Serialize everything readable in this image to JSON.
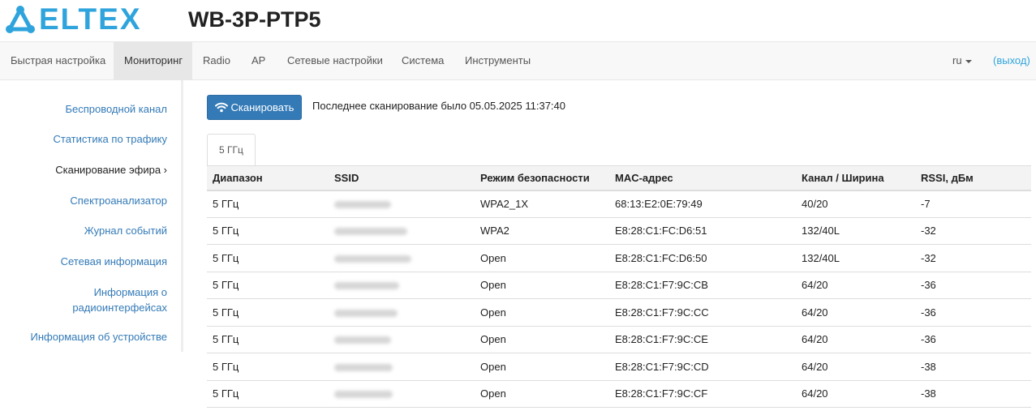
{
  "header": {
    "logo_text": "ELTEX",
    "device_title": "WB-3P-PTP5"
  },
  "nav": {
    "items": [
      "Быстрая настройка",
      "Мониторинг",
      "Radio",
      "AP",
      "Сетевые настройки",
      "Система",
      "Инструменты"
    ],
    "active": "Мониторинг",
    "lang": "ru",
    "logout": "(выход)"
  },
  "sidebar": {
    "items": [
      "Беспроводной канал",
      "Статистика по трафику",
      "Сканирование эфира ›",
      "Спектроанализатор",
      "Журнал событий",
      "Сетевая информация",
      "Информация о радиоинтерфейсах",
      "Информация об устройстве"
    ],
    "current": "Сканирование эфира ›"
  },
  "scan": {
    "button_label": "Сканировать",
    "last_scan_text": "Последнее сканирование было 05.05.2025 11:37:40",
    "tab_label": "5 ГГц"
  },
  "table": {
    "headers": [
      "Диапазон",
      "SSID",
      "Режим безопасности",
      "MAC-адрес",
      "Канал / Ширина",
      "RSSI, дБм"
    ],
    "rows": [
      [
        "5 ГГц",
        "",
        "WPA2_1X",
        "68:13:E2:0E:79:49",
        "40/20",
        "-7"
      ],
      [
        "5 ГГц",
        "",
        "WPA2",
        "E8:28:C1:FC:D6:51",
        "132/40L",
        "-32"
      ],
      [
        "5 ГГц",
        "",
        "Open",
        "E8:28:C1:FC:D6:50",
        "132/40L",
        "-32"
      ],
      [
        "5 ГГц",
        "",
        "Open",
        "E8:28:C1:F7:9C:CB",
        "64/20",
        "-36"
      ],
      [
        "5 ГГц",
        "",
        "Open",
        "E8:28:C1:F7:9C:CC",
        "64/20",
        "-36"
      ],
      [
        "5 ГГц",
        "",
        "Open",
        "E8:28:C1:F7:9C:CE",
        "64/20",
        "-36"
      ],
      [
        "5 ГГц",
        "",
        "Open",
        "E8:28:C1:F7:9C:CD",
        "64/20",
        "-38"
      ],
      [
        "5 ГГц",
        "",
        "Open",
        "E8:28:C1:F7:9C:CF",
        "64/20",
        "-38"
      ]
    ]
  },
  "colors": {
    "brand": "#2fa4dc",
    "link": "#337ab7",
    "button": "#337ab7"
  }
}
